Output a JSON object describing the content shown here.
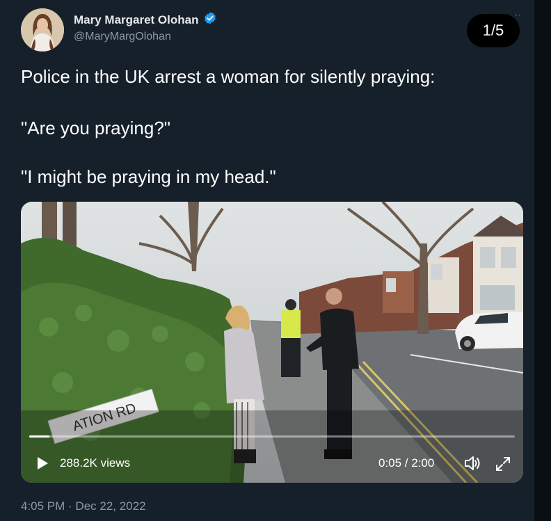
{
  "author": {
    "display_name": "Mary Margaret Olohan",
    "handle": "@MaryMargOlohan",
    "verified": true
  },
  "media_counter": "1/5",
  "tweet": {
    "line1": "Police in the UK arrest a woman for silently praying:",
    "line2": "\"Are you praying?\"",
    "line3": "\"I might be praying in my head.\""
  },
  "video": {
    "sign_text": "ATION RD",
    "views": "288.2K views",
    "time": "0:05 / 2:00",
    "progress": 0.042
  },
  "timestamp": "4:05 PM · Dec 22, 2022",
  "colors": {
    "background": "#15202b",
    "verified_badge": "#1d9bf0",
    "secondary_text": "#8b98a5"
  },
  "icons": [
    "verified-badge-icon",
    "play-icon",
    "volume-icon",
    "fullscreen-icon"
  ]
}
